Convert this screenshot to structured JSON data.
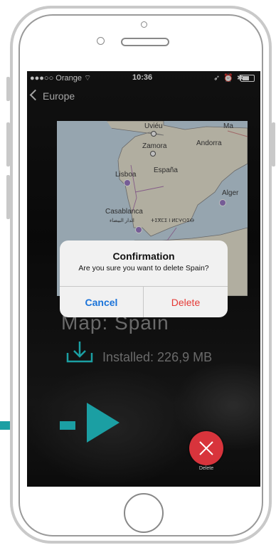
{
  "status_bar": {
    "carrier": "●●●○○ Orange ⌔",
    "time": "10:36",
    "icons": "➶ ⏰ ✱"
  },
  "nav": {
    "back_label": "Europe"
  },
  "map": {
    "labels": {
      "uvieu": "Uviéu",
      "zamora": "Zamora",
      "andorra": "Andorra",
      "espana": "España",
      "lisboa": "Lisboa",
      "casablanca": "Casablanca",
      "berber": "ⵜⵉⴳⵎⵉ ⵏ ⵍⵎⵖⵔⵉⴱ",
      "alger": "Alger",
      "ma": "Ma",
      "arabic": "الدار البيضاء"
    }
  },
  "dialog": {
    "title": "Confirmation",
    "message": "Are you sure you want to delete Spain?",
    "cancel_label": "Cancel",
    "delete_label": "Delete"
  },
  "details": {
    "map_title": "Map: Spain",
    "installed": "Installed: 226,9 MB"
  },
  "fab": {
    "delete_label": "Delete"
  },
  "colors": {
    "accent": "#1b9fa3",
    "delete_red": "#d8343c",
    "link_blue": "#1a73d9",
    "destructive": "#e53935"
  }
}
